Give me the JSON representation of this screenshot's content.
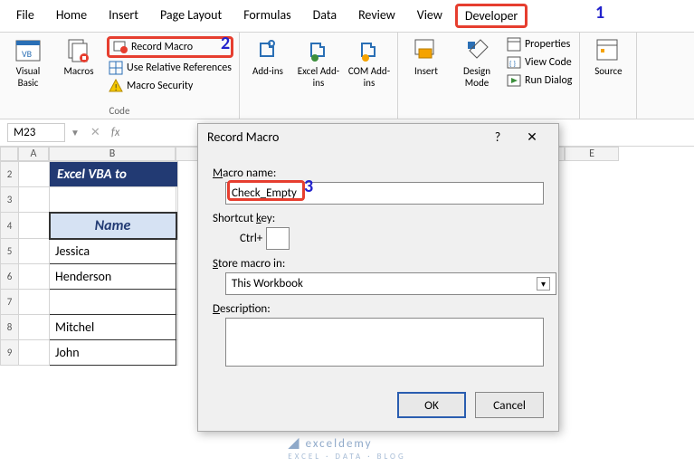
{
  "tabs": {
    "file": "File",
    "home": "Home",
    "insert": "Insert",
    "pagelayout": "Page Layout",
    "formulas": "Formulas",
    "data": "Data",
    "review": "Review",
    "view": "View",
    "developer": "Developer"
  },
  "ribbon": {
    "visualbasic": "Visual Basic",
    "macros": "Macros",
    "recordmacro": "Record Macro",
    "userel": "Use Relative References",
    "macrosec": "Macro Security",
    "code_group": "Code",
    "addins": "Add-ins",
    "exceladdins": "Excel Add-ins",
    "comaddins": "COM Add-ins",
    "insert": "Insert",
    "designmode": "Design Mode",
    "properties": "Properties",
    "viewcode": "View Code",
    "rundialog": "Run Dialog",
    "source": "Source"
  },
  "namebox": "M23",
  "grid": {
    "cols": {
      "a": "A",
      "b": "B",
      "e": "E"
    },
    "rows": [
      "2",
      "3",
      "4",
      "5",
      "6",
      "7",
      "8",
      "9"
    ],
    "banner": "Excel VBA to",
    "nameh": "Name",
    "names": [
      "Jessica",
      "Henderson",
      "",
      "Mitchel",
      "John"
    ]
  },
  "dlg": {
    "title": "Record Macro",
    "macro_name_label": "Macro name:",
    "macro_name": "Check_Empty",
    "shortcut_label": "Shortcut key:",
    "ctrl": "Ctrl+",
    "store_label": "Store macro in:",
    "store_value": "This Workbook",
    "desc_label": "Description:",
    "ok": "OK",
    "cancel": "Cancel",
    "help": "?",
    "close": "✕"
  },
  "annotations": {
    "a1": "1",
    "a2": "2",
    "a3": "3"
  },
  "watermark": {
    "main": "exceldemy",
    "sub": "EXCEL · DATA · BLOG"
  }
}
